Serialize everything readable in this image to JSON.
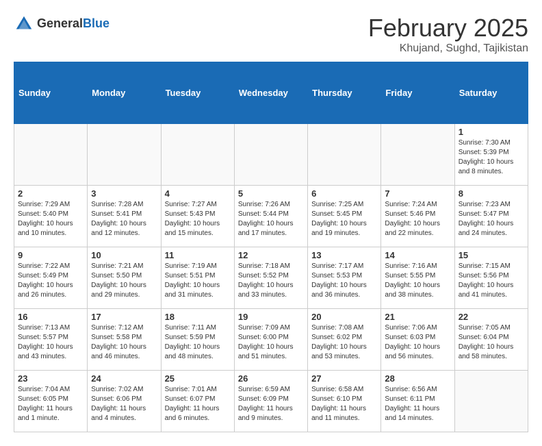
{
  "header": {
    "logo_general": "General",
    "logo_blue": "Blue",
    "month_title": "February 2025",
    "location": "Khujand, Sughd, Tajikistan"
  },
  "weekdays": [
    "Sunday",
    "Monday",
    "Tuesday",
    "Wednesday",
    "Thursday",
    "Friday",
    "Saturday"
  ],
  "weeks": [
    [
      {
        "day": "",
        "info": ""
      },
      {
        "day": "",
        "info": ""
      },
      {
        "day": "",
        "info": ""
      },
      {
        "day": "",
        "info": ""
      },
      {
        "day": "",
        "info": ""
      },
      {
        "day": "",
        "info": ""
      },
      {
        "day": "1",
        "info": "Sunrise: 7:30 AM\nSunset: 5:39 PM\nDaylight: 10 hours and 8 minutes."
      }
    ],
    [
      {
        "day": "2",
        "info": "Sunrise: 7:29 AM\nSunset: 5:40 PM\nDaylight: 10 hours and 10 minutes."
      },
      {
        "day": "3",
        "info": "Sunrise: 7:28 AM\nSunset: 5:41 PM\nDaylight: 10 hours and 12 minutes."
      },
      {
        "day": "4",
        "info": "Sunrise: 7:27 AM\nSunset: 5:43 PM\nDaylight: 10 hours and 15 minutes."
      },
      {
        "day": "5",
        "info": "Sunrise: 7:26 AM\nSunset: 5:44 PM\nDaylight: 10 hours and 17 minutes."
      },
      {
        "day": "6",
        "info": "Sunrise: 7:25 AM\nSunset: 5:45 PM\nDaylight: 10 hours and 19 minutes."
      },
      {
        "day": "7",
        "info": "Sunrise: 7:24 AM\nSunset: 5:46 PM\nDaylight: 10 hours and 22 minutes."
      },
      {
        "day": "8",
        "info": "Sunrise: 7:23 AM\nSunset: 5:47 PM\nDaylight: 10 hours and 24 minutes."
      }
    ],
    [
      {
        "day": "9",
        "info": "Sunrise: 7:22 AM\nSunset: 5:49 PM\nDaylight: 10 hours and 26 minutes."
      },
      {
        "day": "10",
        "info": "Sunrise: 7:21 AM\nSunset: 5:50 PM\nDaylight: 10 hours and 29 minutes."
      },
      {
        "day": "11",
        "info": "Sunrise: 7:19 AM\nSunset: 5:51 PM\nDaylight: 10 hours and 31 minutes."
      },
      {
        "day": "12",
        "info": "Sunrise: 7:18 AM\nSunset: 5:52 PM\nDaylight: 10 hours and 33 minutes."
      },
      {
        "day": "13",
        "info": "Sunrise: 7:17 AM\nSunset: 5:53 PM\nDaylight: 10 hours and 36 minutes."
      },
      {
        "day": "14",
        "info": "Sunrise: 7:16 AM\nSunset: 5:55 PM\nDaylight: 10 hours and 38 minutes."
      },
      {
        "day": "15",
        "info": "Sunrise: 7:15 AM\nSunset: 5:56 PM\nDaylight: 10 hours and 41 minutes."
      }
    ],
    [
      {
        "day": "16",
        "info": "Sunrise: 7:13 AM\nSunset: 5:57 PM\nDaylight: 10 hours and 43 minutes."
      },
      {
        "day": "17",
        "info": "Sunrise: 7:12 AM\nSunset: 5:58 PM\nDaylight: 10 hours and 46 minutes."
      },
      {
        "day": "18",
        "info": "Sunrise: 7:11 AM\nSunset: 5:59 PM\nDaylight: 10 hours and 48 minutes."
      },
      {
        "day": "19",
        "info": "Sunrise: 7:09 AM\nSunset: 6:00 PM\nDaylight: 10 hours and 51 minutes."
      },
      {
        "day": "20",
        "info": "Sunrise: 7:08 AM\nSunset: 6:02 PM\nDaylight: 10 hours and 53 minutes."
      },
      {
        "day": "21",
        "info": "Sunrise: 7:06 AM\nSunset: 6:03 PM\nDaylight: 10 hours and 56 minutes."
      },
      {
        "day": "22",
        "info": "Sunrise: 7:05 AM\nSunset: 6:04 PM\nDaylight: 10 hours and 58 minutes."
      }
    ],
    [
      {
        "day": "23",
        "info": "Sunrise: 7:04 AM\nSunset: 6:05 PM\nDaylight: 11 hours and 1 minute."
      },
      {
        "day": "24",
        "info": "Sunrise: 7:02 AM\nSunset: 6:06 PM\nDaylight: 11 hours and 4 minutes."
      },
      {
        "day": "25",
        "info": "Sunrise: 7:01 AM\nSunset: 6:07 PM\nDaylight: 11 hours and 6 minutes."
      },
      {
        "day": "26",
        "info": "Sunrise: 6:59 AM\nSunset: 6:09 PM\nDaylight: 11 hours and 9 minutes."
      },
      {
        "day": "27",
        "info": "Sunrise: 6:58 AM\nSunset: 6:10 PM\nDaylight: 11 hours and 11 minutes."
      },
      {
        "day": "28",
        "info": "Sunrise: 6:56 AM\nSunset: 6:11 PM\nDaylight: 11 hours and 14 minutes."
      },
      {
        "day": "",
        "info": ""
      }
    ]
  ]
}
